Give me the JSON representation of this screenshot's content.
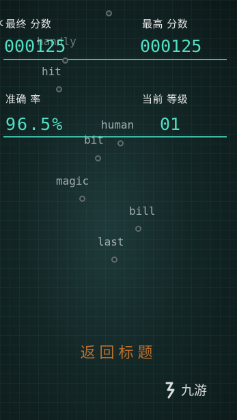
{
  "stats": {
    "final_score_label": "最终 分数",
    "final_score_value": "000125",
    "high_score_label": "最高 分数",
    "high_score_value": "000125",
    "accuracy_label": "准确 率",
    "accuracy_value": "96.5%",
    "level_label": "当前 等级",
    "level_value": "01",
    "edge_fragment": "k"
  },
  "words": [
    "handly",
    "hit",
    "human",
    "bit",
    "magic",
    "bill",
    "last"
  ],
  "colors": {
    "accent": "#4fe0c4",
    "rule": "#3fb9a6",
    "button": "#b96e2c"
  },
  "back_button_label": "返回标题",
  "watermark": {
    "text": "九游",
    "icon": "logo-icon"
  }
}
